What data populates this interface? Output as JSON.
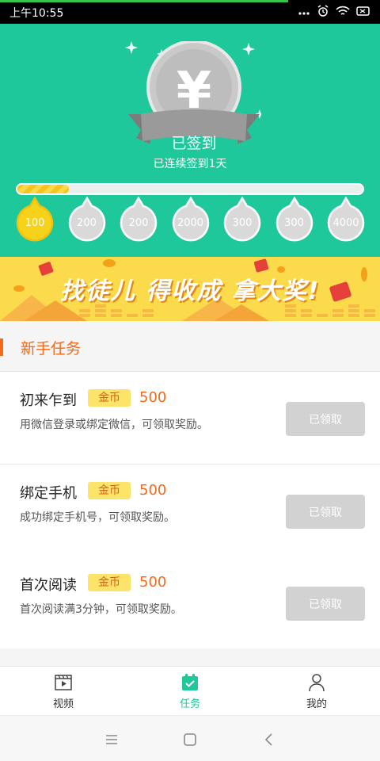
{
  "status_bar": {
    "time": "上午10:55",
    "icons": [
      "more-dots-icon",
      "alarm-icon",
      "wifi-icon",
      "battery-icon"
    ]
  },
  "checkin": {
    "coin_symbol": "¥",
    "ribbon_label": "已签到",
    "streak_text": "已连续签到1天",
    "progress": 0.15,
    "rewards": [
      {
        "value": "100",
        "claimed": true
      },
      {
        "value": "200",
        "claimed": false
      },
      {
        "value": "200",
        "claimed": false
      },
      {
        "value": "2000",
        "claimed": false
      },
      {
        "value": "300",
        "claimed": false
      },
      {
        "value": "300",
        "claimed": false
      },
      {
        "value": "4000",
        "claimed": false
      }
    ]
  },
  "banner": {
    "text": "找徒儿 得收成 拿大奖!"
  },
  "section": {
    "title": "新手任务"
  },
  "tasks": [
    {
      "name": "初来乍到",
      "badge": "金币",
      "reward": "500",
      "desc": "用微信登录或绑定微信，可领取奖励。",
      "button": "已领取"
    },
    {
      "name": "绑定手机",
      "badge": "金币",
      "reward": "500",
      "desc": "成功绑定手机号，可领取奖励。",
      "button": "已领取"
    },
    {
      "name": "首次阅读",
      "badge": "金币",
      "reward": "500",
      "desc": "首次阅读满3分钟，可领取奖励。",
      "button": "已领取"
    }
  ],
  "tabbar": {
    "tabs": [
      {
        "label": "视频",
        "icon": "video-icon",
        "active": false
      },
      {
        "label": "任务",
        "icon": "task-calendar-icon",
        "active": true
      },
      {
        "label": "我的",
        "icon": "profile-icon",
        "active": false
      }
    ]
  },
  "colors": {
    "primary_green": "#1fc89a",
    "accent_orange": "#f26a1b",
    "gold": "#fce46a",
    "claimed_gray": "#d2d2d2"
  }
}
